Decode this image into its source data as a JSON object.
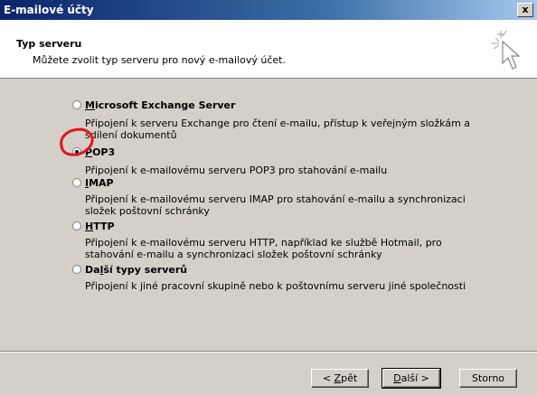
{
  "window": {
    "title": "E-mailové účty",
    "close_label": "x"
  },
  "header": {
    "title": "Typ serveru",
    "subtitle": "Můžete zvolit typ serveru pro nový e-mailový účet."
  },
  "options": [
    {
      "prefix": "",
      "mnemonic": "M",
      "suffix": "icrosoft Exchange Server",
      "desc": "Připojení k serveru Exchange pro čtení e-mailu, přístup k veřejným složkám a sdílení dokumentů",
      "selected": false
    },
    {
      "prefix": "",
      "mnemonic": "P",
      "suffix": "OP3",
      "desc": "Připojení k e-mailovému serveru POP3 pro stahování e-mailu",
      "selected": true
    },
    {
      "prefix": "",
      "mnemonic": "I",
      "suffix": "MAP",
      "desc": "Připojení k e-mailovému serveru IMAP pro stahování e-mailu a synchronizaci složek poštovní schránky",
      "selected": false
    },
    {
      "prefix": "",
      "mnemonic": "H",
      "suffix": "TTP",
      "desc": "Připojení k e-mailovému serveru HTTP, například ke službě Hotmail, pro stahování e-mailu a synchronizaci složek poštovní schránky",
      "selected": false
    },
    {
      "prefix": "Da",
      "mnemonic": "l",
      "suffix": "ší typy serverů",
      "desc": "Připojení k jiné pracovní skupině nebo k poštovnímu serveru jiné společnosti",
      "selected": false
    }
  ],
  "buttons": {
    "back": {
      "prefix": "< ",
      "mnemonic": "Z",
      "suffix": "pět"
    },
    "next": {
      "prefix": "",
      "mnemonic": "D",
      "suffix": "alší >"
    },
    "cancel": "Storno"
  }
}
